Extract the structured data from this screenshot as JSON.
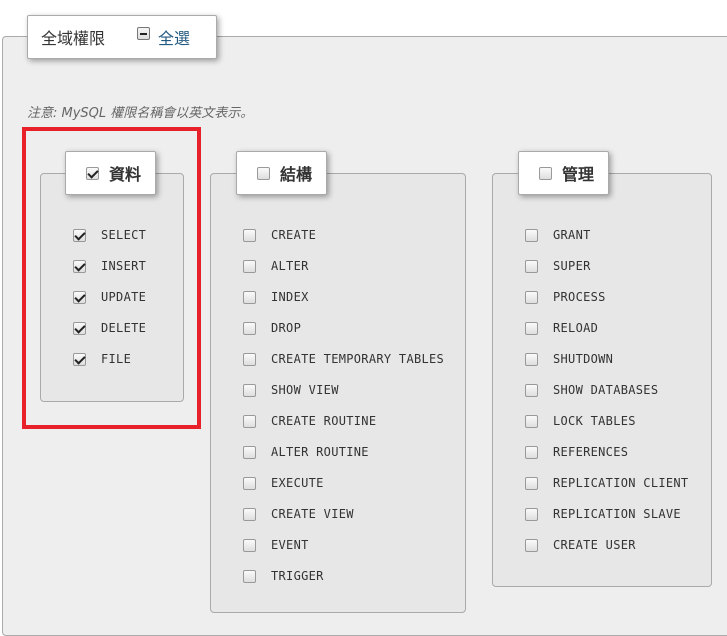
{
  "header": {
    "title": "全域權限",
    "select_all_label": "全選"
  },
  "note": "注意: MySQL 權限名稱會以英文表示。",
  "groups": {
    "data": {
      "title": "資料",
      "checked": true,
      "items": [
        {
          "label": "SELECT",
          "checked": true
        },
        {
          "label": "INSERT",
          "checked": true
        },
        {
          "label": "UPDATE",
          "checked": true
        },
        {
          "label": "DELETE",
          "checked": true
        },
        {
          "label": "FILE",
          "checked": true
        }
      ]
    },
    "structure": {
      "title": "結構",
      "checked": false,
      "items": [
        {
          "label": "CREATE",
          "checked": false
        },
        {
          "label": "ALTER",
          "checked": false
        },
        {
          "label": "INDEX",
          "checked": false
        },
        {
          "label": "DROP",
          "checked": false
        },
        {
          "label": "CREATE TEMPORARY TABLES",
          "checked": false
        },
        {
          "label": "SHOW VIEW",
          "checked": false
        },
        {
          "label": "CREATE ROUTINE",
          "checked": false
        },
        {
          "label": "ALTER ROUTINE",
          "checked": false
        },
        {
          "label": "EXECUTE",
          "checked": false
        },
        {
          "label": "CREATE VIEW",
          "checked": false
        },
        {
          "label": "EVENT",
          "checked": false
        },
        {
          "label": "TRIGGER",
          "checked": false
        }
      ]
    },
    "admin": {
      "title": "管理",
      "checked": false,
      "items": [
        {
          "label": "GRANT",
          "checked": false
        },
        {
          "label": "SUPER",
          "checked": false
        },
        {
          "label": "PROCESS",
          "checked": false
        },
        {
          "label": "RELOAD",
          "checked": false
        },
        {
          "label": "SHUTDOWN",
          "checked": false
        },
        {
          "label": "SHOW DATABASES",
          "checked": false
        },
        {
          "label": "LOCK TABLES",
          "checked": false
        },
        {
          "label": "REFERENCES",
          "checked": false
        },
        {
          "label": "REPLICATION CLIENT",
          "checked": false
        },
        {
          "label": "REPLICATION SLAVE",
          "checked": false
        },
        {
          "label": "CREATE USER",
          "checked": false
        }
      ]
    }
  },
  "colors": {
    "highlight": "#e8202a",
    "link": "#235a81",
    "panel_bg": "#eeeeee"
  }
}
